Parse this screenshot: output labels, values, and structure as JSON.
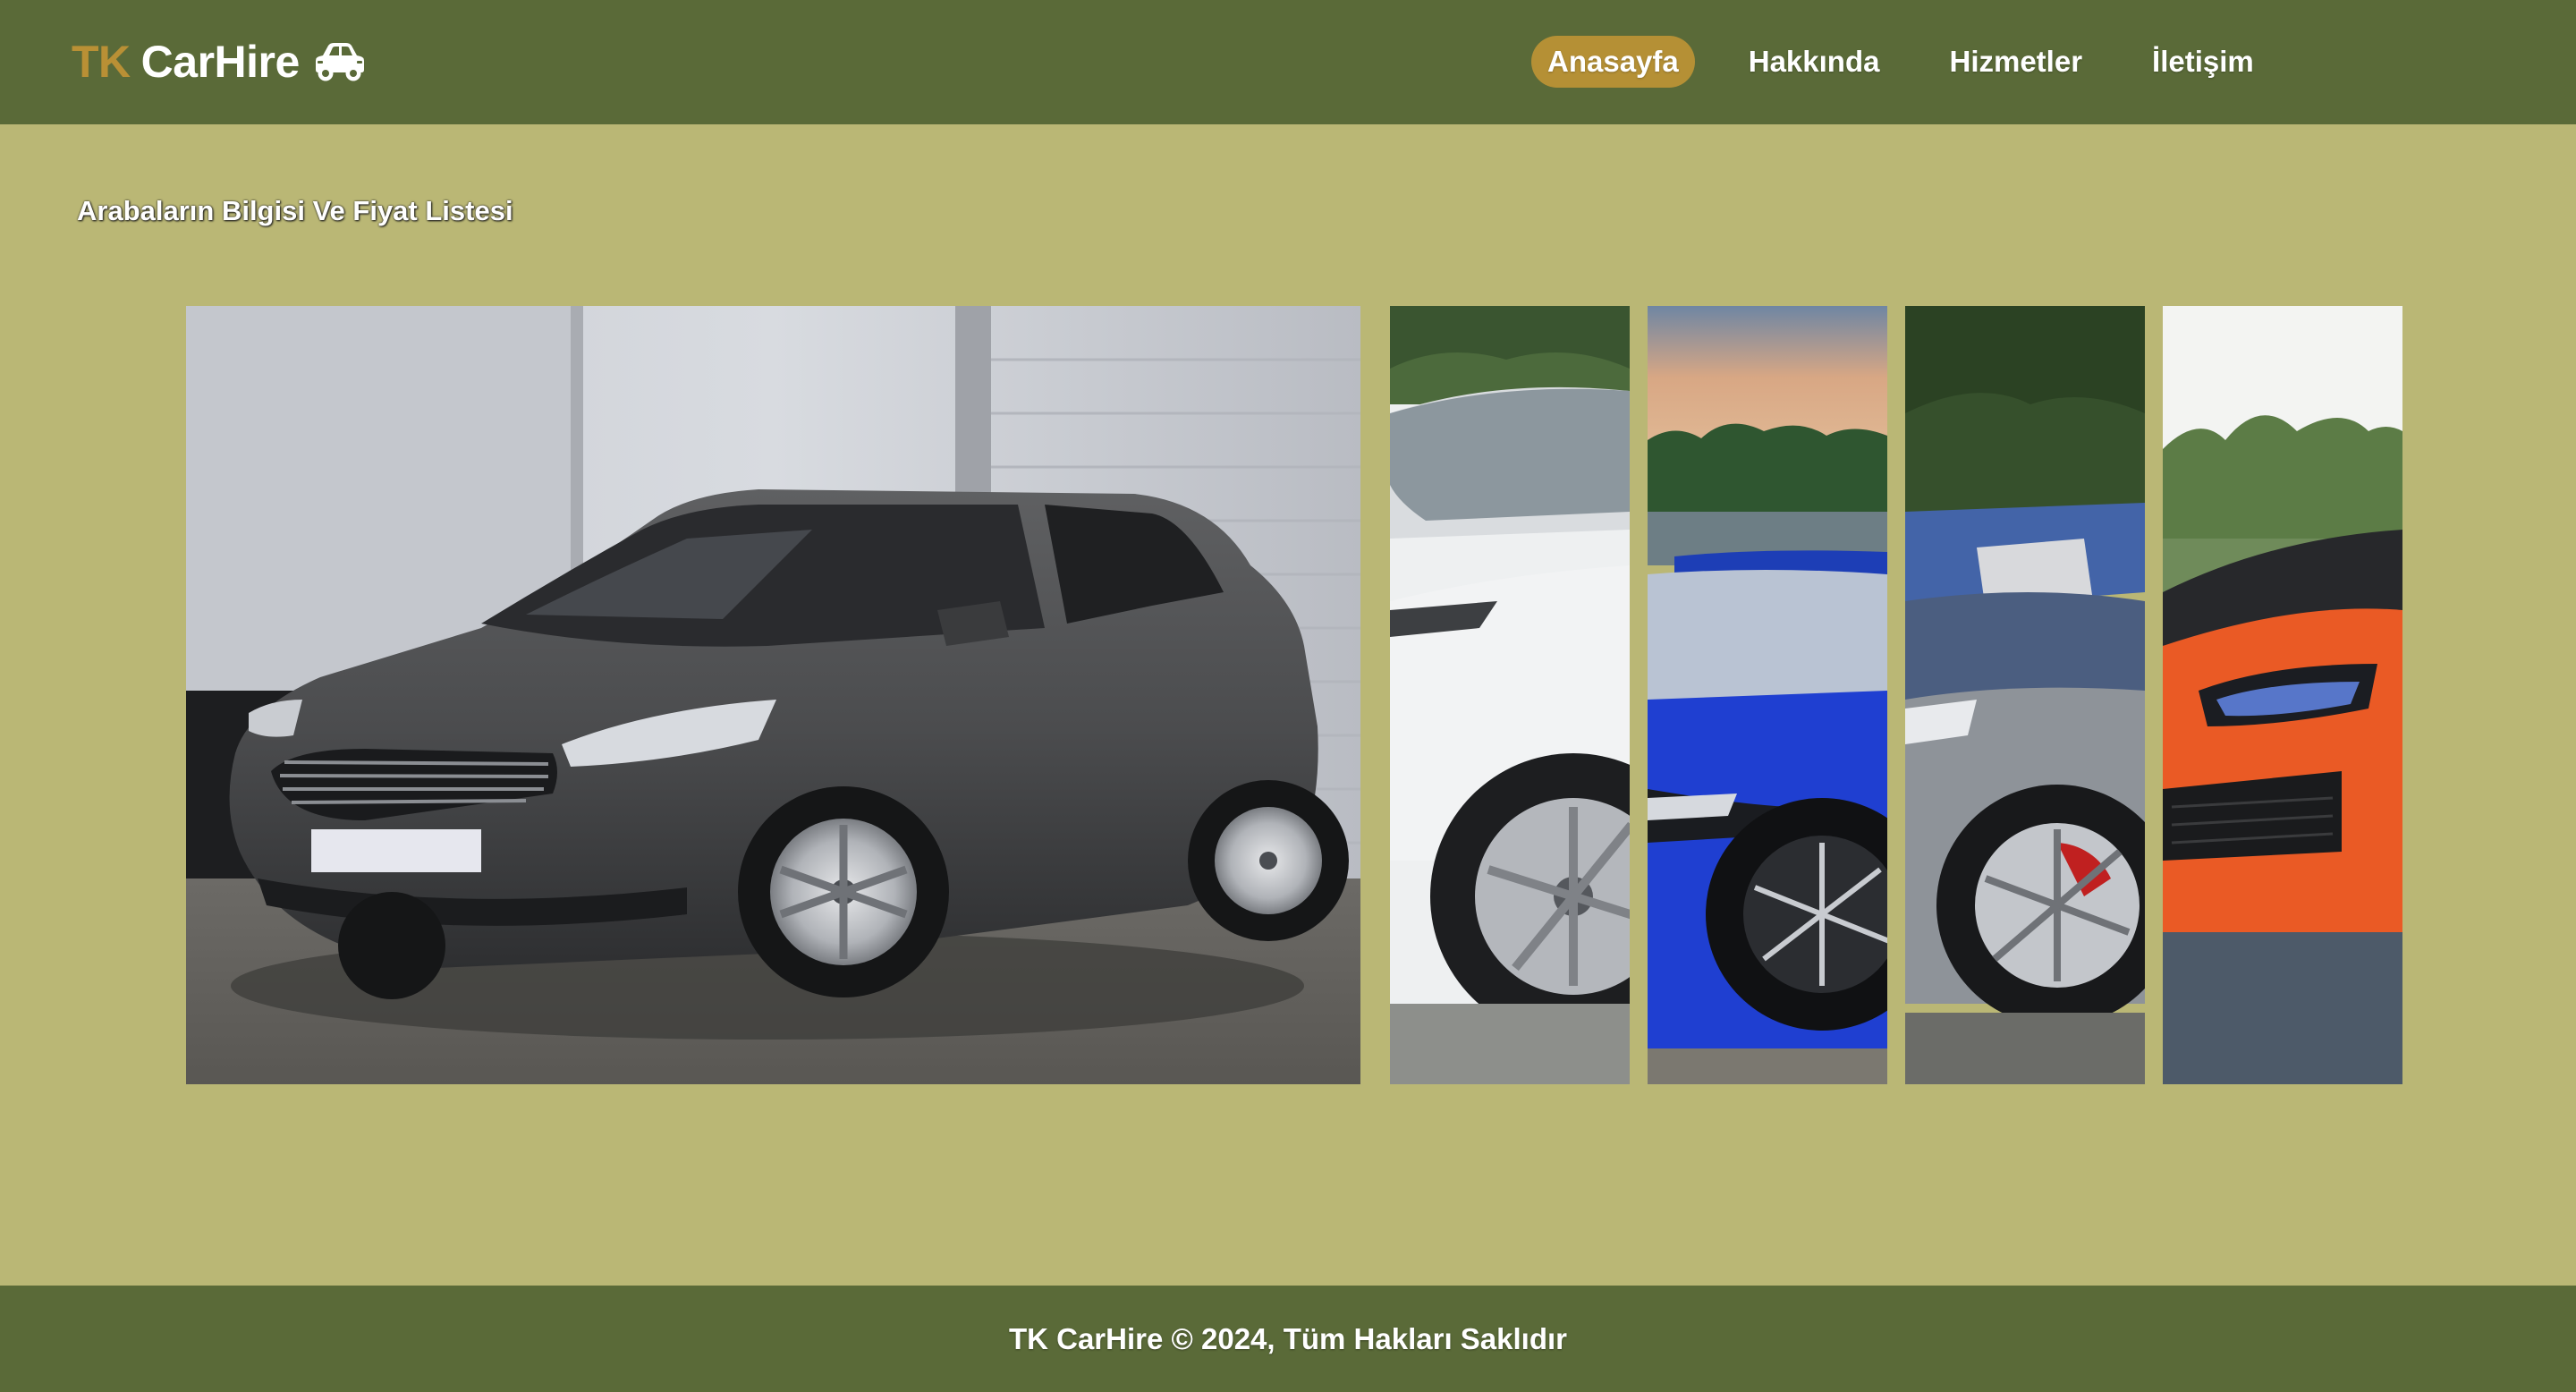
{
  "brand": {
    "prefix": "TK",
    "name": "CarHire",
    "icon": "car-icon",
    "prefix_color": "#b99035"
  },
  "nav": {
    "items": [
      {
        "label": "Anasayfa",
        "active": true
      },
      {
        "label": "Hakkında",
        "active": false
      },
      {
        "label": "Hizmetler",
        "active": false
      },
      {
        "label": "İletişim",
        "active": false
      }
    ]
  },
  "main": {
    "title": "Arabaların Bilgisi Ve Fiyat Listesi",
    "gallery": [
      {
        "name": "dark-grey-hatchback",
        "expanded": true
      },
      {
        "name": "white-suv",
        "expanded": false
      },
      {
        "name": "blue-sports-sedan",
        "expanded": false
      },
      {
        "name": "silver-convertible",
        "expanded": false
      },
      {
        "name": "orange-sports-car",
        "expanded": false
      }
    ]
  },
  "footer": {
    "text": "TK CarHire © 2024, Tüm Hakları Saklıdır"
  },
  "colors": {
    "header_bg": "#5a6a38",
    "page_bg": "#bab775",
    "accent": "#b59035",
    "text": "#ffffff"
  }
}
